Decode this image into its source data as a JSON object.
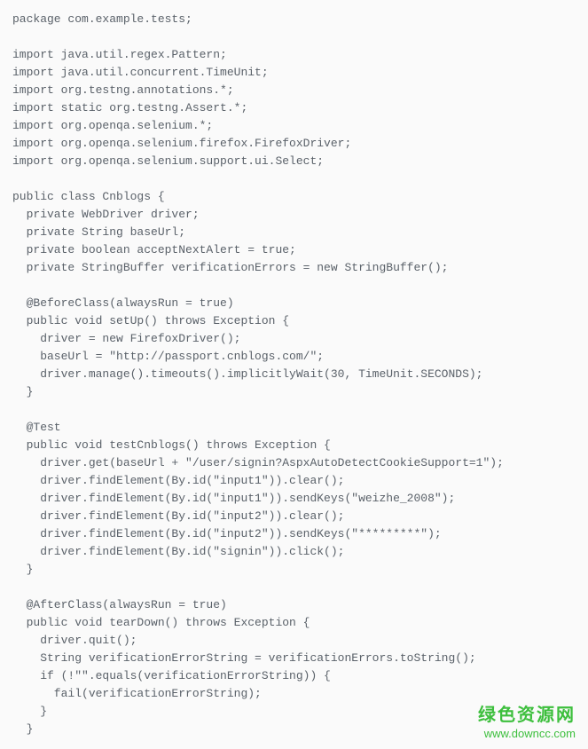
{
  "code": {
    "lines": [
      "package com.example.tests;",
      "",
      "import java.util.regex.Pattern;",
      "import java.util.concurrent.TimeUnit;",
      "import org.testng.annotations.*;",
      "import static org.testng.Assert.*;",
      "import org.openqa.selenium.*;",
      "import org.openqa.selenium.firefox.FirefoxDriver;",
      "import org.openqa.selenium.support.ui.Select;",
      "",
      "public class Cnblogs {",
      "  private WebDriver driver;",
      "  private String baseUrl;",
      "  private boolean acceptNextAlert = true;",
      "  private StringBuffer verificationErrors = new StringBuffer();",
      "",
      "  @BeforeClass(alwaysRun = true)",
      "  public void setUp() throws Exception {",
      "    driver = new FirefoxDriver();",
      "    baseUrl = \"http://passport.cnblogs.com/\";",
      "    driver.manage().timeouts().implicitlyWait(30, TimeUnit.SECONDS);",
      "  }",
      "",
      "  @Test",
      "  public void testCnblogs() throws Exception {",
      "    driver.get(baseUrl + \"/user/signin?AspxAutoDetectCookieSupport=1\");",
      "    driver.findElement(By.id(\"input1\")).clear();",
      "    driver.findElement(By.id(\"input1\")).sendKeys(\"weizhe_2008\");",
      "    driver.findElement(By.id(\"input2\")).clear();",
      "    driver.findElement(By.id(\"input2\")).sendKeys(\"*********\");",
      "    driver.findElement(By.id(\"signin\")).click();",
      "  }",
      "",
      "  @AfterClass(alwaysRun = true)",
      "  public void tearDown() throws Exception {",
      "    driver.quit();",
      "    String verificationErrorString = verificationErrors.toString();",
      "    if (!\"\".equals(verificationErrorString)) {",
      "      fail(verificationErrorString);",
      "    }",
      "  }"
    ]
  },
  "watermark": {
    "line1": "绿色资源网",
    "line2": "www.downcc.com"
  }
}
